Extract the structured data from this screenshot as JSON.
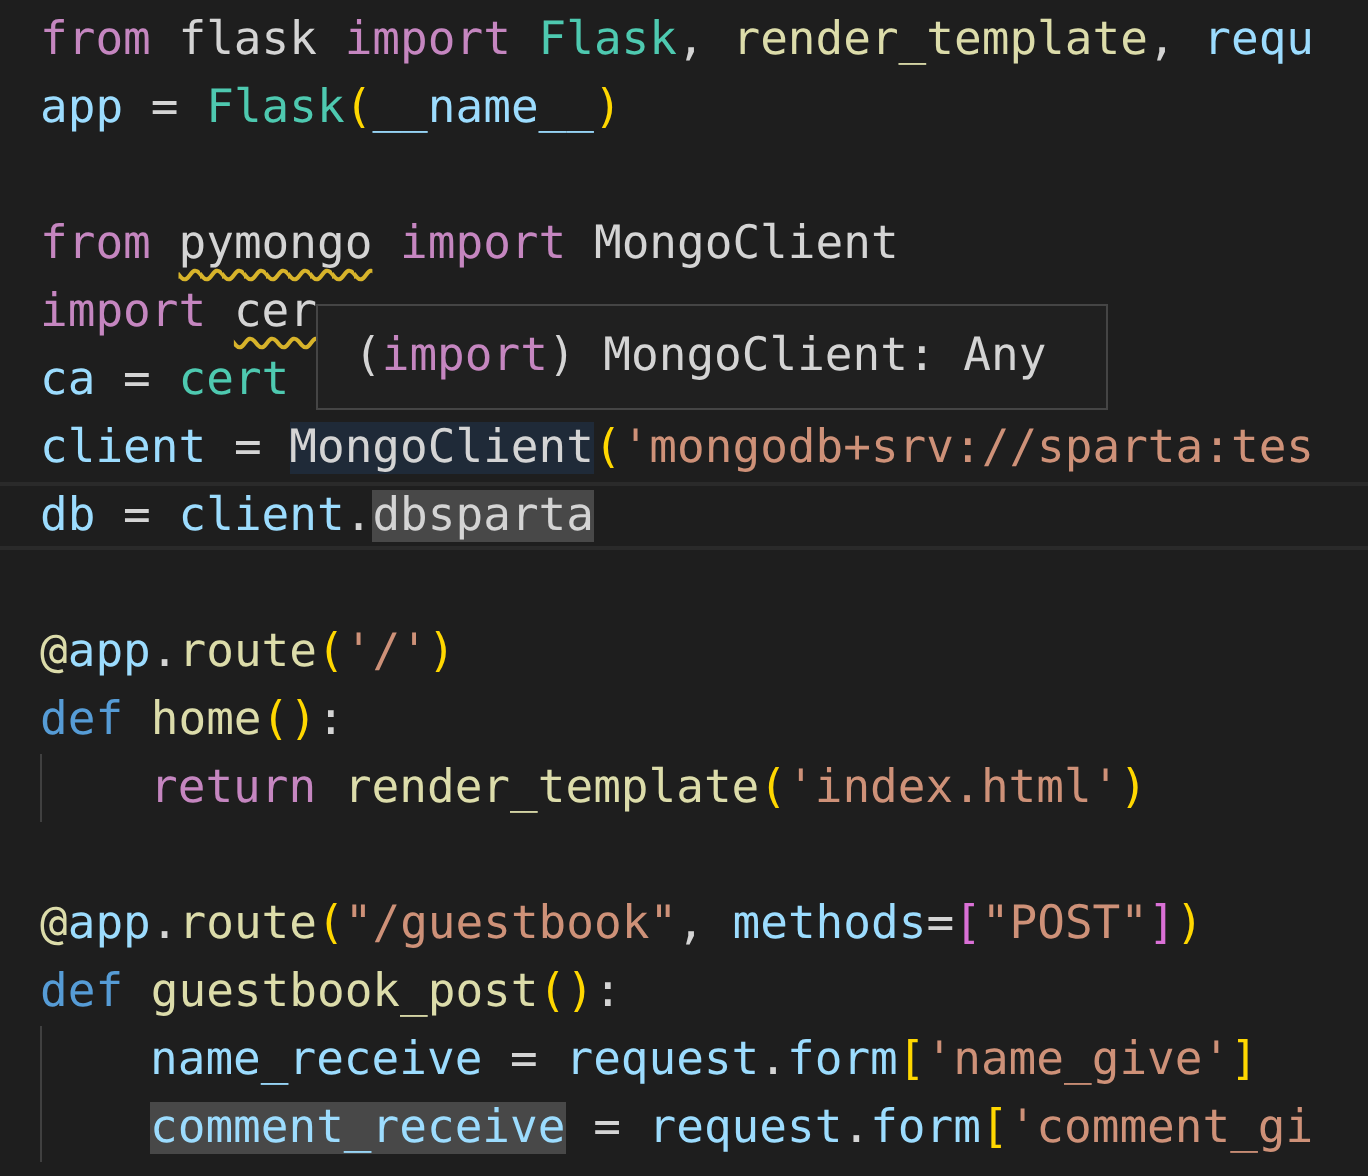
{
  "editor": {
    "lines": [
      {
        "tokens": [
          {
            "text": "from",
            "kind": "keyword"
          },
          {
            "text": " flask ",
            "kind": "plain"
          },
          {
            "text": "import",
            "kind": "keyword"
          },
          {
            "text": " Flask",
            "kind": "class"
          },
          {
            "text": ", ",
            "kind": "plain"
          },
          {
            "text": "render_template",
            "kind": "function"
          },
          {
            "text": ", ",
            "kind": "plain"
          },
          {
            "text": "requ",
            "kind": "variable"
          }
        ]
      },
      {
        "tokens": [
          {
            "text": "app",
            "kind": "variable"
          },
          {
            "text": " = ",
            "kind": "plain"
          },
          {
            "text": "Flask",
            "kind": "class"
          },
          {
            "text": "(",
            "kind": "bracket"
          },
          {
            "text": "__name__",
            "kind": "variable"
          },
          {
            "text": ")",
            "kind": "bracket"
          }
        ]
      },
      {
        "blank_before": true,
        "tokens": [
          {
            "text": "from ",
            "kind": "keyword"
          },
          {
            "text": "pymongo",
            "kind": "plain",
            "squiggly": true
          },
          {
            "text": " import",
            "kind": "keyword"
          },
          {
            "text": " MongoClient",
            "kind": "plain"
          }
        ]
      },
      {
        "tokens": [
          {
            "text": "import ",
            "kind": "keyword"
          },
          {
            "text": "cer",
            "kind": "plain",
            "squiggly": true
          }
        ]
      },
      {
        "tokens": [
          {
            "text": "ca",
            "kind": "variable"
          },
          {
            "text": " = ",
            "kind": "plain"
          },
          {
            "text": "cert",
            "kind": "class"
          }
        ]
      },
      {
        "tokens": [
          {
            "text": "client",
            "kind": "variable"
          },
          {
            "text": " = ",
            "kind": "plain"
          },
          {
            "text": "MongoClient",
            "kind": "plain",
            "reference_highlight": true
          },
          {
            "text": "(",
            "kind": "bracket"
          },
          {
            "text": "'mongodb+srv://sparta:tes",
            "kind": "string"
          }
        ],
        "current": false
      },
      {
        "tokens": [
          {
            "text": "db",
            "kind": "variable"
          },
          {
            "text": " = ",
            "kind": "plain"
          },
          {
            "text": "client",
            "kind": "variable"
          },
          {
            "text": ".",
            "kind": "plain"
          },
          {
            "text": "dbsparta",
            "kind": "plain",
            "selected": true
          }
        ],
        "current": true
      },
      {
        "blank_before": true,
        "tokens": [
          {
            "text": "@",
            "kind": "function"
          },
          {
            "text": "app",
            "kind": "variable"
          },
          {
            "text": ".",
            "kind": "plain"
          },
          {
            "text": "route",
            "kind": "function"
          },
          {
            "text": "(",
            "kind": "bracket"
          },
          {
            "text": "'/'",
            "kind": "string"
          },
          {
            "text": ")",
            "kind": "bracket"
          }
        ]
      },
      {
        "tokens": [
          {
            "text": "def",
            "kind": "storage"
          },
          {
            "text": " home",
            "kind": "function"
          },
          {
            "text": "()",
            "kind": "bracket"
          },
          {
            "text": ":",
            "kind": "plain"
          }
        ]
      },
      {
        "guide": true,
        "tokens": [
          {
            "text": "return",
            "kind": "keyword"
          },
          {
            "text": " render_template",
            "kind": "function"
          },
          {
            "text": "(",
            "kind": "bracket"
          },
          {
            "text": "'index.html'",
            "kind": "string"
          },
          {
            "text": ")",
            "kind": "bracket"
          }
        ]
      },
      {
        "blank_before": true,
        "tokens": [
          {
            "text": "@",
            "kind": "function"
          },
          {
            "text": "app",
            "kind": "variable"
          },
          {
            "text": ".",
            "kind": "plain"
          },
          {
            "text": "route",
            "kind": "function"
          },
          {
            "text": "(",
            "kind": "bracket"
          },
          {
            "text": "\"/guestbook\"",
            "kind": "string"
          },
          {
            "text": ", ",
            "kind": "plain"
          },
          {
            "text": "methods",
            "kind": "variable"
          },
          {
            "text": "=",
            "kind": "plain"
          },
          {
            "text": "[",
            "kind": "bracket2"
          },
          {
            "text": "\"POST\"",
            "kind": "string"
          },
          {
            "text": "]",
            "kind": "bracket2"
          },
          {
            "text": ")",
            "kind": "bracket"
          }
        ]
      },
      {
        "tokens": [
          {
            "text": "def",
            "kind": "storage"
          },
          {
            "text": " guestbook_post",
            "kind": "function"
          },
          {
            "text": "()",
            "kind": "bracket"
          },
          {
            "text": ":",
            "kind": "plain"
          }
        ]
      },
      {
        "guide": true,
        "tokens": [
          {
            "text": "name_receive",
            "kind": "variable"
          },
          {
            "text": " = ",
            "kind": "plain"
          },
          {
            "text": "request",
            "kind": "variable"
          },
          {
            "text": ".",
            "kind": "plain"
          },
          {
            "text": "form",
            "kind": "variable"
          },
          {
            "text": "[",
            "kind": "bracket"
          },
          {
            "text": "'name_give'",
            "kind": "string"
          },
          {
            "text": "]",
            "kind": "bracket"
          }
        ]
      },
      {
        "guide": true,
        "tokens": [
          {
            "text": "comment_receive",
            "kind": "variable",
            "selected": true
          },
          {
            "text": " = ",
            "kind": "plain"
          },
          {
            "text": "request",
            "kind": "variable"
          },
          {
            "text": ".",
            "kind": "plain"
          },
          {
            "text": "form",
            "kind": "variable"
          },
          {
            "text": "[",
            "kind": "bracket"
          },
          {
            "text": "'comment_gi",
            "kind": "string"
          }
        ]
      }
    ]
  },
  "hover": {
    "tokens": [
      {
        "text": "(",
        "kind": "plain"
      },
      {
        "text": "import",
        "kind": "keyword"
      },
      {
        "text": ") MongoClient: Any",
        "kind": "plain"
      }
    ]
  }
}
